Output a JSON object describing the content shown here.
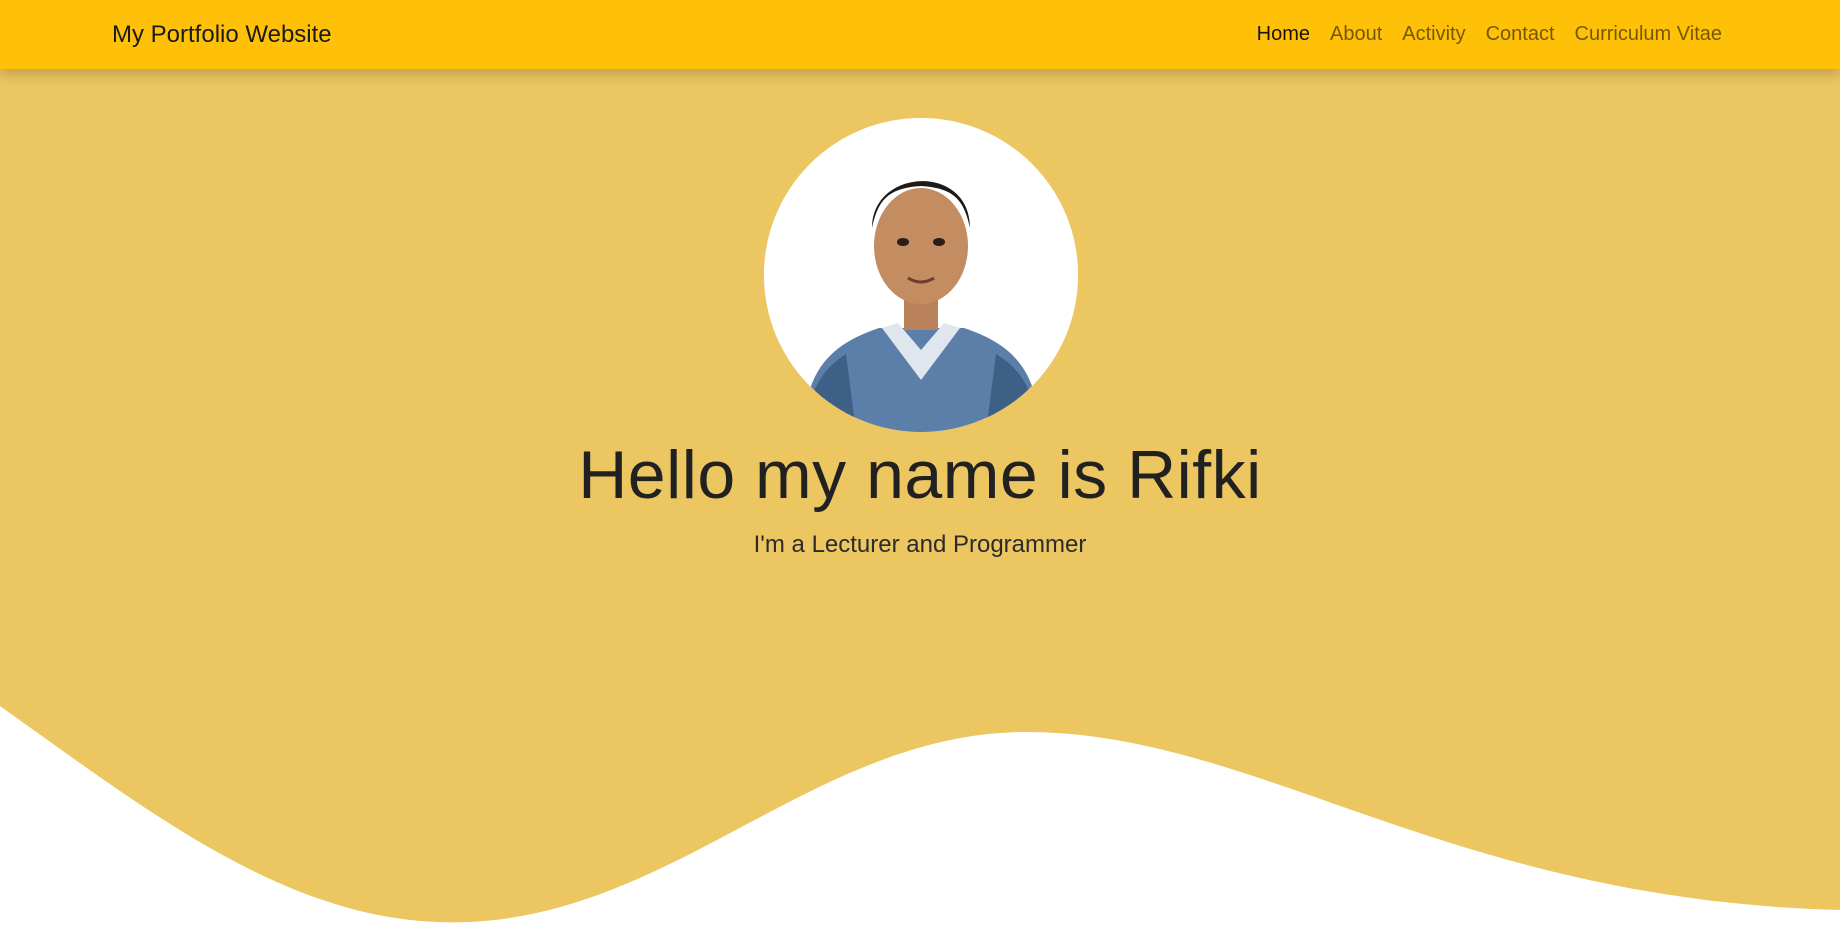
{
  "navbar": {
    "brand": "My Portfolio Website",
    "links": [
      {
        "label": "Home",
        "active": true
      },
      {
        "label": "About",
        "active": false
      },
      {
        "label": "Activity",
        "active": false
      },
      {
        "label": "Contact",
        "active": false
      },
      {
        "label": "Curriculum Vitae",
        "active": false
      }
    ]
  },
  "hero": {
    "avatar_icon": "profile-photo-icon",
    "title": "Hello my name is Rifki",
    "subtitle": "I'm a Lecturer and Programmer"
  },
  "colors": {
    "navbar_background": "#ffc107",
    "hero_background": "#ecc660",
    "wave_fill": "#ffffff",
    "text_dark": "#212121"
  }
}
